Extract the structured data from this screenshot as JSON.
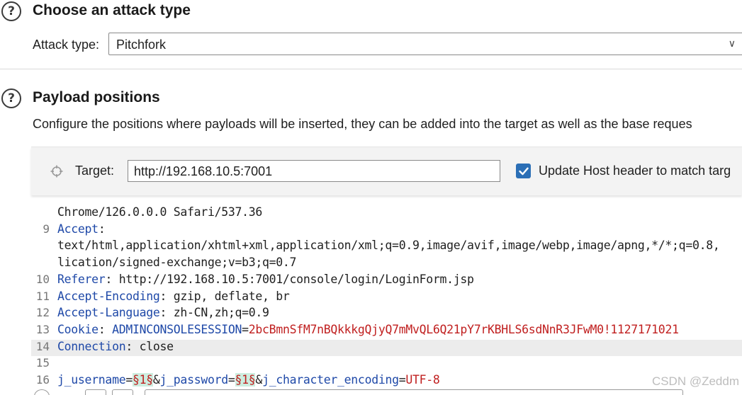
{
  "attack_section": {
    "help_glyph": "?",
    "title": "Choose an attack type",
    "attack_type_label": "Attack type:",
    "attack_type_value": "Pitchfork",
    "dropdown_glyph": "∨"
  },
  "payload_section": {
    "help_glyph": "?",
    "title": "Payload positions",
    "description": "Configure the positions where payloads will be inserted, they can be added into the target as well as the base reques"
  },
  "target_bar": {
    "icon": "crosshair-icon",
    "label": "Target:",
    "url": "http://192.168.10.5:7001",
    "update_host_checked": true,
    "update_host_label": "Update Host header to match targ"
  },
  "request_lines": [
    {
      "num": "",
      "segments": [
        {
          "t": "Chrome/126.0.0.0 Safari/537.36",
          "c": "plain"
        }
      ]
    },
    {
      "num": "9",
      "segments": [
        {
          "t": "Accept",
          "c": "key"
        },
        {
          "t": ":",
          "c": "plain"
        }
      ]
    },
    {
      "num": "",
      "segments": [
        {
          "t": "text/html,application/xhtml+xml,application/xml;q=0.9,image/avif,image/webp,image/apng,*/*;q=0.8,",
          "c": "plain"
        }
      ]
    },
    {
      "num": "",
      "segments": [
        {
          "t": "lication/signed-exchange;v=b3;q=0.7",
          "c": "plain"
        }
      ]
    },
    {
      "num": "10",
      "segments": [
        {
          "t": "Referer",
          "c": "key"
        },
        {
          "t": ": http://192.168.10.5:7001/console/login/LoginForm.jsp",
          "c": "plain"
        }
      ]
    },
    {
      "num": "11",
      "segments": [
        {
          "t": "Accept-Encoding",
          "c": "key"
        },
        {
          "t": ": gzip, deflate, br",
          "c": "plain"
        }
      ]
    },
    {
      "num": "12",
      "segments": [
        {
          "t": "Accept-Language",
          "c": "key"
        },
        {
          "t": ": zh-CN,zh;q=0.9",
          "c": "plain"
        }
      ]
    },
    {
      "num": "13",
      "segments": [
        {
          "t": "Cookie",
          "c": "key"
        },
        {
          "t": ": ",
          "c": "plain"
        },
        {
          "t": "ADMINCONSOLESESSION",
          "c": "key"
        },
        {
          "t": "=",
          "c": "plain"
        },
        {
          "t": "2bcBmnSfM7nBQkkkgQjyQ7mMvQL6Q21pY7rKBHLS6sdNnR3JFwM0!1127171021",
          "c": "val"
        }
      ]
    },
    {
      "num": "14",
      "highlight": true,
      "segments": [
        {
          "t": "Connection",
          "c": "key"
        },
        {
          "t": ": close",
          "c": "plain"
        }
      ]
    },
    {
      "num": "15",
      "segments": []
    },
    {
      "num": "16",
      "segments": [
        {
          "t": "j_username",
          "c": "key"
        },
        {
          "t": "=",
          "c": "plain"
        },
        {
          "t": "§1§",
          "c": "mark"
        },
        {
          "t": "&",
          "c": "plain"
        },
        {
          "t": "j_password",
          "c": "key"
        },
        {
          "t": "=",
          "c": "plain"
        },
        {
          "t": "§1§",
          "c": "mark"
        },
        {
          "t": "&",
          "c": "plain"
        },
        {
          "t": "j_character_encoding",
          "c": "key"
        },
        {
          "t": "=",
          "c": "plain"
        },
        {
          "t": "UTF-8",
          "c": "val"
        }
      ]
    }
  ],
  "watermark": "CSDN @Zeddm",
  "colors": {
    "key": "#1f49a8",
    "value": "#c01f1f",
    "payload_marker_bg": "#cdeee0",
    "checkbox": "#2b6fb6"
  }
}
